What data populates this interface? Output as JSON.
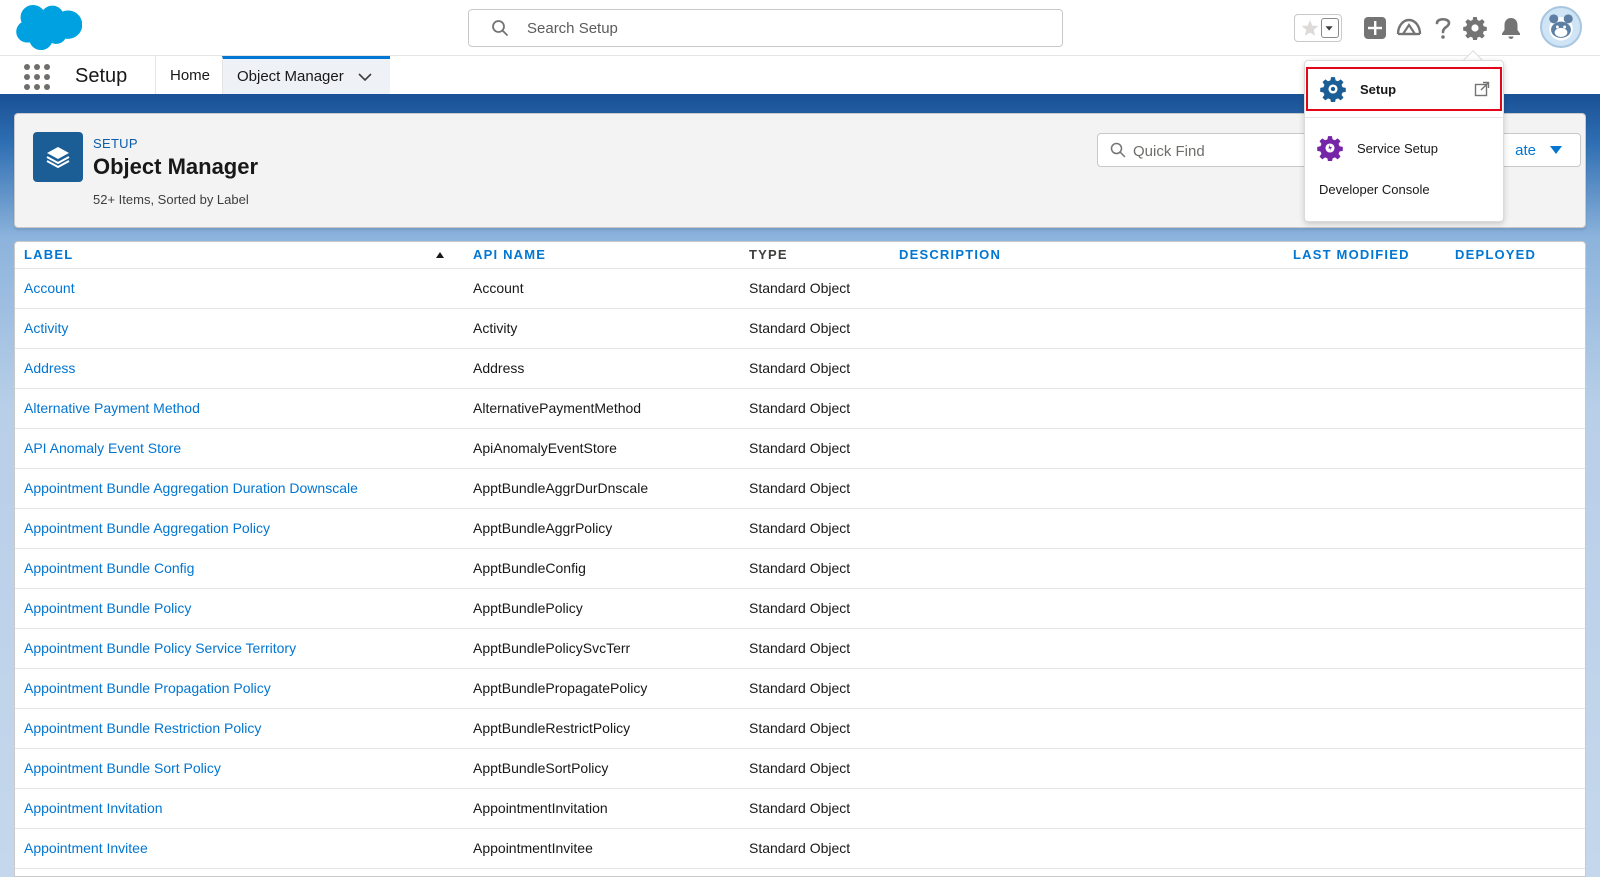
{
  "global_header": {
    "search_placeholder": "Search Setup",
    "icons": [
      "salesforce-cloud-logo",
      "search-icon",
      "star-icon",
      "chevron-down-icon",
      "add-icon",
      "trailhead-icon",
      "help-icon",
      "gear-icon",
      "bell-icon",
      "avatar"
    ]
  },
  "context_bar": {
    "app_name": "Setup",
    "tabs": [
      {
        "label": "Home"
      },
      {
        "label": "Object Manager",
        "active": true
      }
    ]
  },
  "page_header": {
    "eyebrow": "SETUP",
    "title": "Object Manager",
    "meta": "52+ Items, Sorted by Label",
    "quick_find_placeholder": "Quick Find",
    "create_label": "ate"
  },
  "table": {
    "columns": [
      "LABEL",
      "API NAME",
      "TYPE",
      "DESCRIPTION",
      "LAST MODIFIED",
      "DEPLOYED"
    ],
    "sorted_column": "LABEL",
    "sort_direction": "ascending",
    "rows": [
      {
        "label": "Account",
        "api": "Account",
        "type": "Standard Object"
      },
      {
        "label": "Activity",
        "api": "Activity",
        "type": "Standard Object"
      },
      {
        "label": "Address",
        "api": "Address",
        "type": "Standard Object"
      },
      {
        "label": "Alternative Payment Method",
        "api": "AlternativePaymentMethod",
        "type": "Standard Object"
      },
      {
        "label": "API Anomaly Event Store",
        "api": "ApiAnomalyEventStore",
        "type": "Standard Object"
      },
      {
        "label": "Appointment Bundle Aggregation Duration Downscale",
        "api": "ApptBundleAggrDurDnscale",
        "type": "Standard Object"
      },
      {
        "label": "Appointment Bundle Aggregation Policy",
        "api": "ApptBundleAggrPolicy",
        "type": "Standard Object"
      },
      {
        "label": "Appointment Bundle Config",
        "api": "ApptBundleConfig",
        "type": "Standard Object"
      },
      {
        "label": "Appointment Bundle Policy",
        "api": "ApptBundlePolicy",
        "type": "Standard Object"
      },
      {
        "label": "Appointment Bundle Policy Service Territory",
        "api": "ApptBundlePolicySvcTerr",
        "type": "Standard Object"
      },
      {
        "label": "Appointment Bundle Propagation Policy",
        "api": "ApptBundlePropagatePolicy",
        "type": "Standard Object"
      },
      {
        "label": "Appointment Bundle Restriction Policy",
        "api": "ApptBundleRestrictPolicy",
        "type": "Standard Object"
      },
      {
        "label": "Appointment Bundle Sort Policy",
        "api": "ApptBundleSortPolicy",
        "type": "Standard Object"
      },
      {
        "label": "Appointment Invitation",
        "api": "AppointmentInvitation",
        "type": "Standard Object"
      },
      {
        "label": "Appointment Invitee",
        "api": "AppointmentInvitee",
        "type": "Standard Object"
      }
    ]
  },
  "setup_menu": {
    "items": [
      {
        "label": "Setup",
        "highlighted": true
      },
      {
        "label": "Service Setup"
      },
      {
        "label": "Developer Console"
      }
    ]
  },
  "colors": {
    "brand_blue": "#0176d3",
    "header_band": "#1b5297",
    "highlight_red": "#e3061b"
  }
}
